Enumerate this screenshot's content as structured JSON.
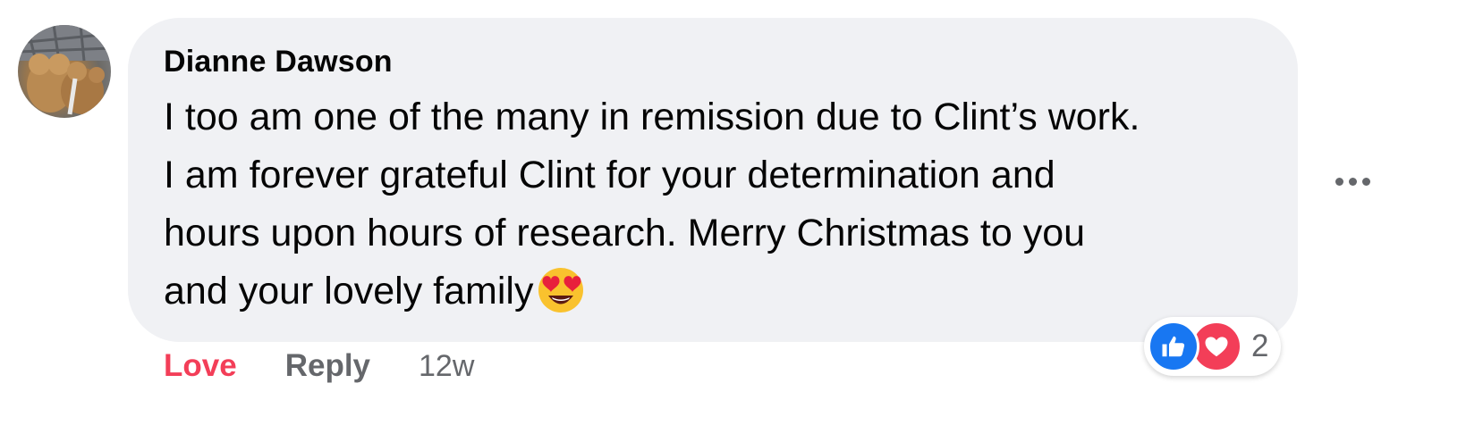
{
  "comment": {
    "author": "Dianne Dawson",
    "text_lines": [
      "I too am one of the many in remission due to Clint’s work.",
      "I am forever grateful Clint for your determination and",
      "hours upon hours of research. Merry Christmas to you",
      "and your lovely family"
    ],
    "emoji": "smiling-face-with-heart-eyes",
    "reaction_count": "2",
    "reaction_types": [
      "like",
      "love"
    ]
  },
  "actions": {
    "love_label": "Love",
    "reply_label": "Reply",
    "timestamp": "12w"
  },
  "colors": {
    "bubble": "#f0f1f4",
    "love": "#f33e58",
    "like": "#1877f2",
    "muted": "#65676b"
  }
}
